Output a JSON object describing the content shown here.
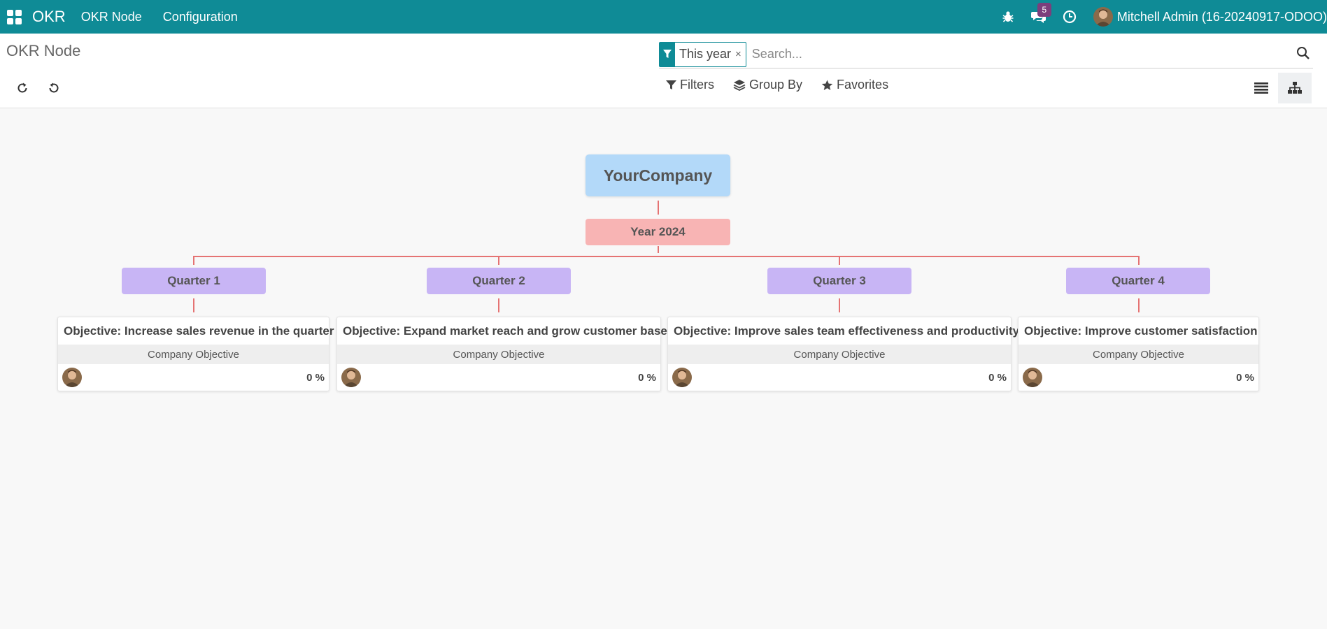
{
  "navbar": {
    "app_name": "OKR",
    "menus": [
      "OKR Node",
      "Configuration"
    ],
    "messages_count": "5",
    "user_name": "Mitchell Admin (16-20240917-ODOO)"
  },
  "control_panel": {
    "title": "OKR Node",
    "facet_value": "This year",
    "facet_remove": "×",
    "search_placeholder": "Search...",
    "filters_label": "Filters",
    "groupby_label": "Group By",
    "favorites_label": "Favorites"
  },
  "tree": {
    "company": "YourCompany",
    "year": "Year 2024",
    "quarters": [
      "Quarter 1",
      "Quarter 2",
      "Quarter 3",
      "Quarter 4"
    ],
    "objectives": [
      {
        "title": "Objective: Increase sales revenue in the quarter",
        "type": "Company Objective",
        "progress": "0 %"
      },
      {
        "title": "Objective: Expand market reach and grow customer base",
        "type": "Company Objective",
        "progress": "0 %"
      },
      {
        "title": "Objective: Improve sales team effectiveness and productivity",
        "type": "Company Objective",
        "progress": "0 %"
      },
      {
        "title": "Objective: Improve customer satisfaction",
        "type": "Company Objective",
        "progress": "0 %"
      }
    ]
  },
  "colors": {
    "navbar": "#0f8b96",
    "company_node": "#b3d9f9",
    "year_node": "#f8b4b4",
    "quarter_node": "#c8b5f5",
    "connector": "#e57373"
  }
}
